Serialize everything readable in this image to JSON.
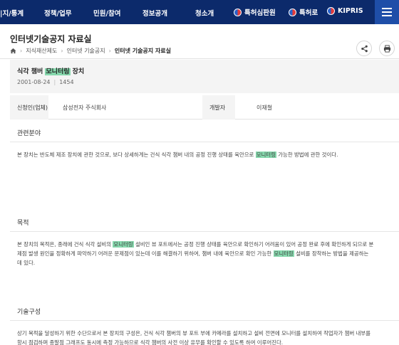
{
  "nav": {
    "items": [
      "|지/통계",
      "정책/업무",
      "민원/참여",
      "정보공개",
      "청소개"
    ],
    "links": [
      "특허심판원",
      "특허로",
      "KIPRIS"
    ]
  },
  "header": {
    "title": "인터넷기술공지 자료실",
    "breadcrumb": [
      "지식재산제도",
      "인터넷 기술공지",
      "인터넷 기술공지 자료실"
    ]
  },
  "doc": {
    "title_pre": "식각 챔버 ",
    "title_hl": "모니터링",
    "title_post": " 장치",
    "date": "2001-08-24",
    "views": "1454"
  },
  "info": {
    "applicant_label": "신청인(업체)",
    "applicant_value": "삼성전자 주식회사",
    "developer_label": "개발자",
    "developer_value": "이재철"
  },
  "sections": {
    "field_title": "관련분야",
    "field_text_pre": "본 장치는 반도체 제조 장치에 관한 것으로, 보다 상세하게는 건식 식각 챔버 내의 공정 진행 상태를 육안으로 ",
    "field_text_hl": "모니터링",
    "field_text_post": " 가능한 방법에 관한 것이다.",
    "purpose_title": "목적",
    "purpose_l1_a": "본 장치의 목적은, 종래에 건식 식각 설비의 ",
    "purpose_l1_hl": "모니터링",
    "purpose_l1_b": " 설비인 뷰 포트에서는 공정 진행 상태를 육안으로 확인하기 어려움이 있어 공정 완료 후에 확인하게 되므로 분",
    "purpose_l2_a": "제점 발생 원인을 정확하게 파악하기 어려운 문제점이 있는데 이를 해결하기 위하여, 챔버 내에 육안으로 확인 가능한 ",
    "purpose_l2_hl": "모니터링",
    "purpose_l2_b": " 설비를 장착하는 방법을 제공하는",
    "purpose_l3": "데 있다.",
    "tech_title": "기술구성",
    "tech_l1": "상기 목적을 달성하기 위한 수단으로서 본 장치의 구성은, 건식 식각 챔버의 뷰 포트 부에 카메라를 설치하고 설비 전면에 모니터를 설치하여 작업자가 챔버 내부를",
    "tech_l2": "항시 점검하며 종말점 그래프도 동시에 측정 가능하므로 식각 챔버의 사전 이상 유무를 확인할 수 있도록 하여 이루어진다."
  },
  "colors": {
    "nav_bg": "#0c2a6b",
    "menu_bg": "#1e4ea8",
    "highlight": "#86d8ad"
  }
}
